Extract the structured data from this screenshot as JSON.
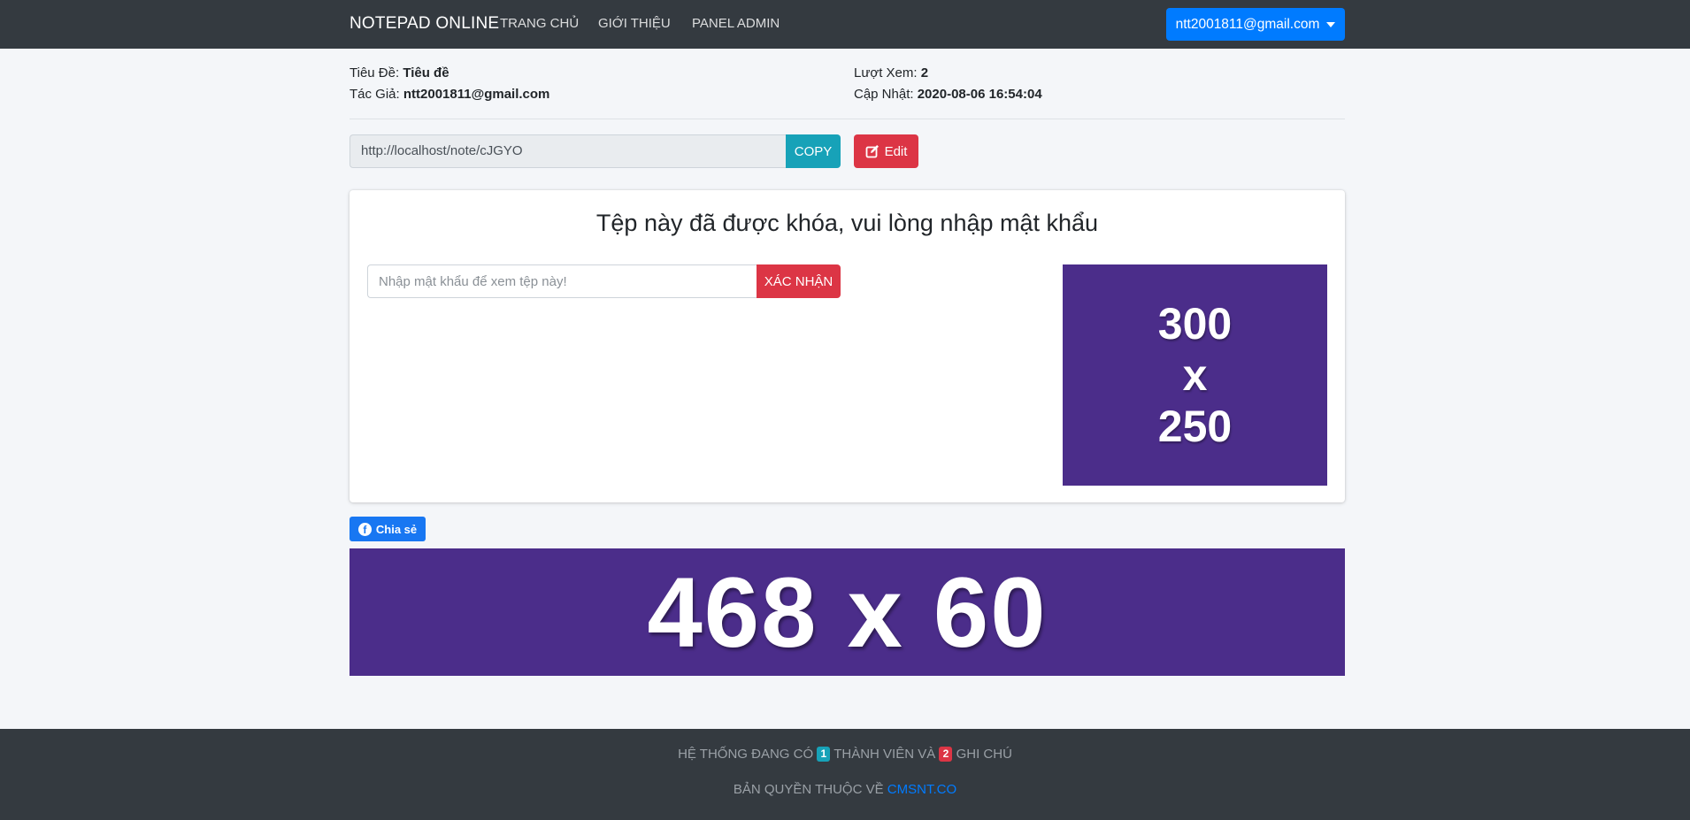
{
  "navbar": {
    "brand": "NOTEPAD ONLINE",
    "links": [
      "TRANG CHỦ",
      "GIỚI THIỆU",
      "PANEL ADMIN"
    ],
    "user": "ntt2001811@gmail.com"
  },
  "meta": {
    "title_label": "Tiêu Đề:",
    "title_value": "Tiêu đề",
    "author_label": "Tác Giả:",
    "author_value": "ntt2001811@gmail.com",
    "views_label": "Lượt Xem:",
    "views_value": "2",
    "updated_label": "Cập Nhật:",
    "updated_value": "2020-08-06 16:54:04"
  },
  "url_bar": {
    "url": "http://localhost/note/cJGYO",
    "copy_label": "COPY",
    "edit_label": "Edit"
  },
  "card": {
    "title": "Tệp này đã được khóa, vui lòng nhập mật khẩu",
    "password_placeholder": "Nhập mật khẩu để xem tệp này!",
    "confirm_label": "XÁC NHẬN",
    "ad_lines": [
      "300",
      "x",
      "250"
    ]
  },
  "share": {
    "label": "Chia sẻ"
  },
  "banner": {
    "text": "468 x 60"
  },
  "footer": {
    "part1": "HỆ THỐNG ĐANG CÓ",
    "members_count": "1",
    "part2": "THÀNH VIÊN VÀ",
    "notes_count": "2",
    "part3": "GHI CHÚ",
    "copyright_prefix": "BẢN QUYỀN THUỘC VỀ",
    "copyright_link": "CMSNT.CO"
  },
  "colors": {
    "navbar_bg": "#343a40",
    "primary": "#007bff",
    "info": "#17a2b8",
    "danger": "#dc3545",
    "ad_purple": "#4b2d8a",
    "facebook": "#1877f2"
  }
}
